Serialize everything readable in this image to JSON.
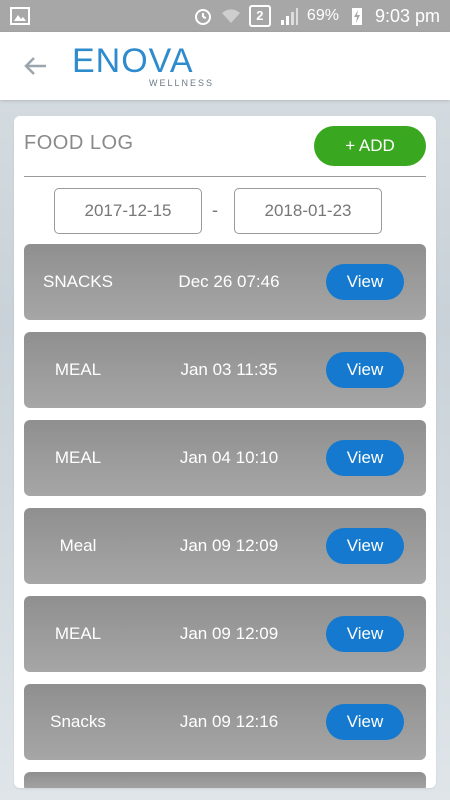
{
  "status_bar": {
    "battery": "69%",
    "time": "9:03 pm",
    "sim": "2"
  },
  "header": {
    "logo_main": "ENOVA",
    "logo_sub": "WELLNESS"
  },
  "food_log": {
    "title": "FOOD LOG",
    "add_label": "+ ADD",
    "date_from": "2017-12-15",
    "date_to": "2018-01-23",
    "separator": "-",
    "entries": [
      {
        "type": "SNACKS",
        "datetime": "Dec 26 07:46",
        "action": "View"
      },
      {
        "type": "MEAL",
        "datetime": "Jan 03 11:35",
        "action": "View"
      },
      {
        "type": "MEAL",
        "datetime": "Jan 04 10:10",
        "action": "View"
      },
      {
        "type": "Meal",
        "datetime": "Jan 09 12:09",
        "action": "View"
      },
      {
        "type": "MEAL",
        "datetime": "Jan 09 12:09",
        "action": "View"
      },
      {
        "type": "Snacks",
        "datetime": "Jan 09 12:16",
        "action": "View"
      }
    ]
  },
  "colors": {
    "accent_blue": "#1479cf",
    "add_green": "#3aa720",
    "logo_blue": "#2e8bcc"
  }
}
